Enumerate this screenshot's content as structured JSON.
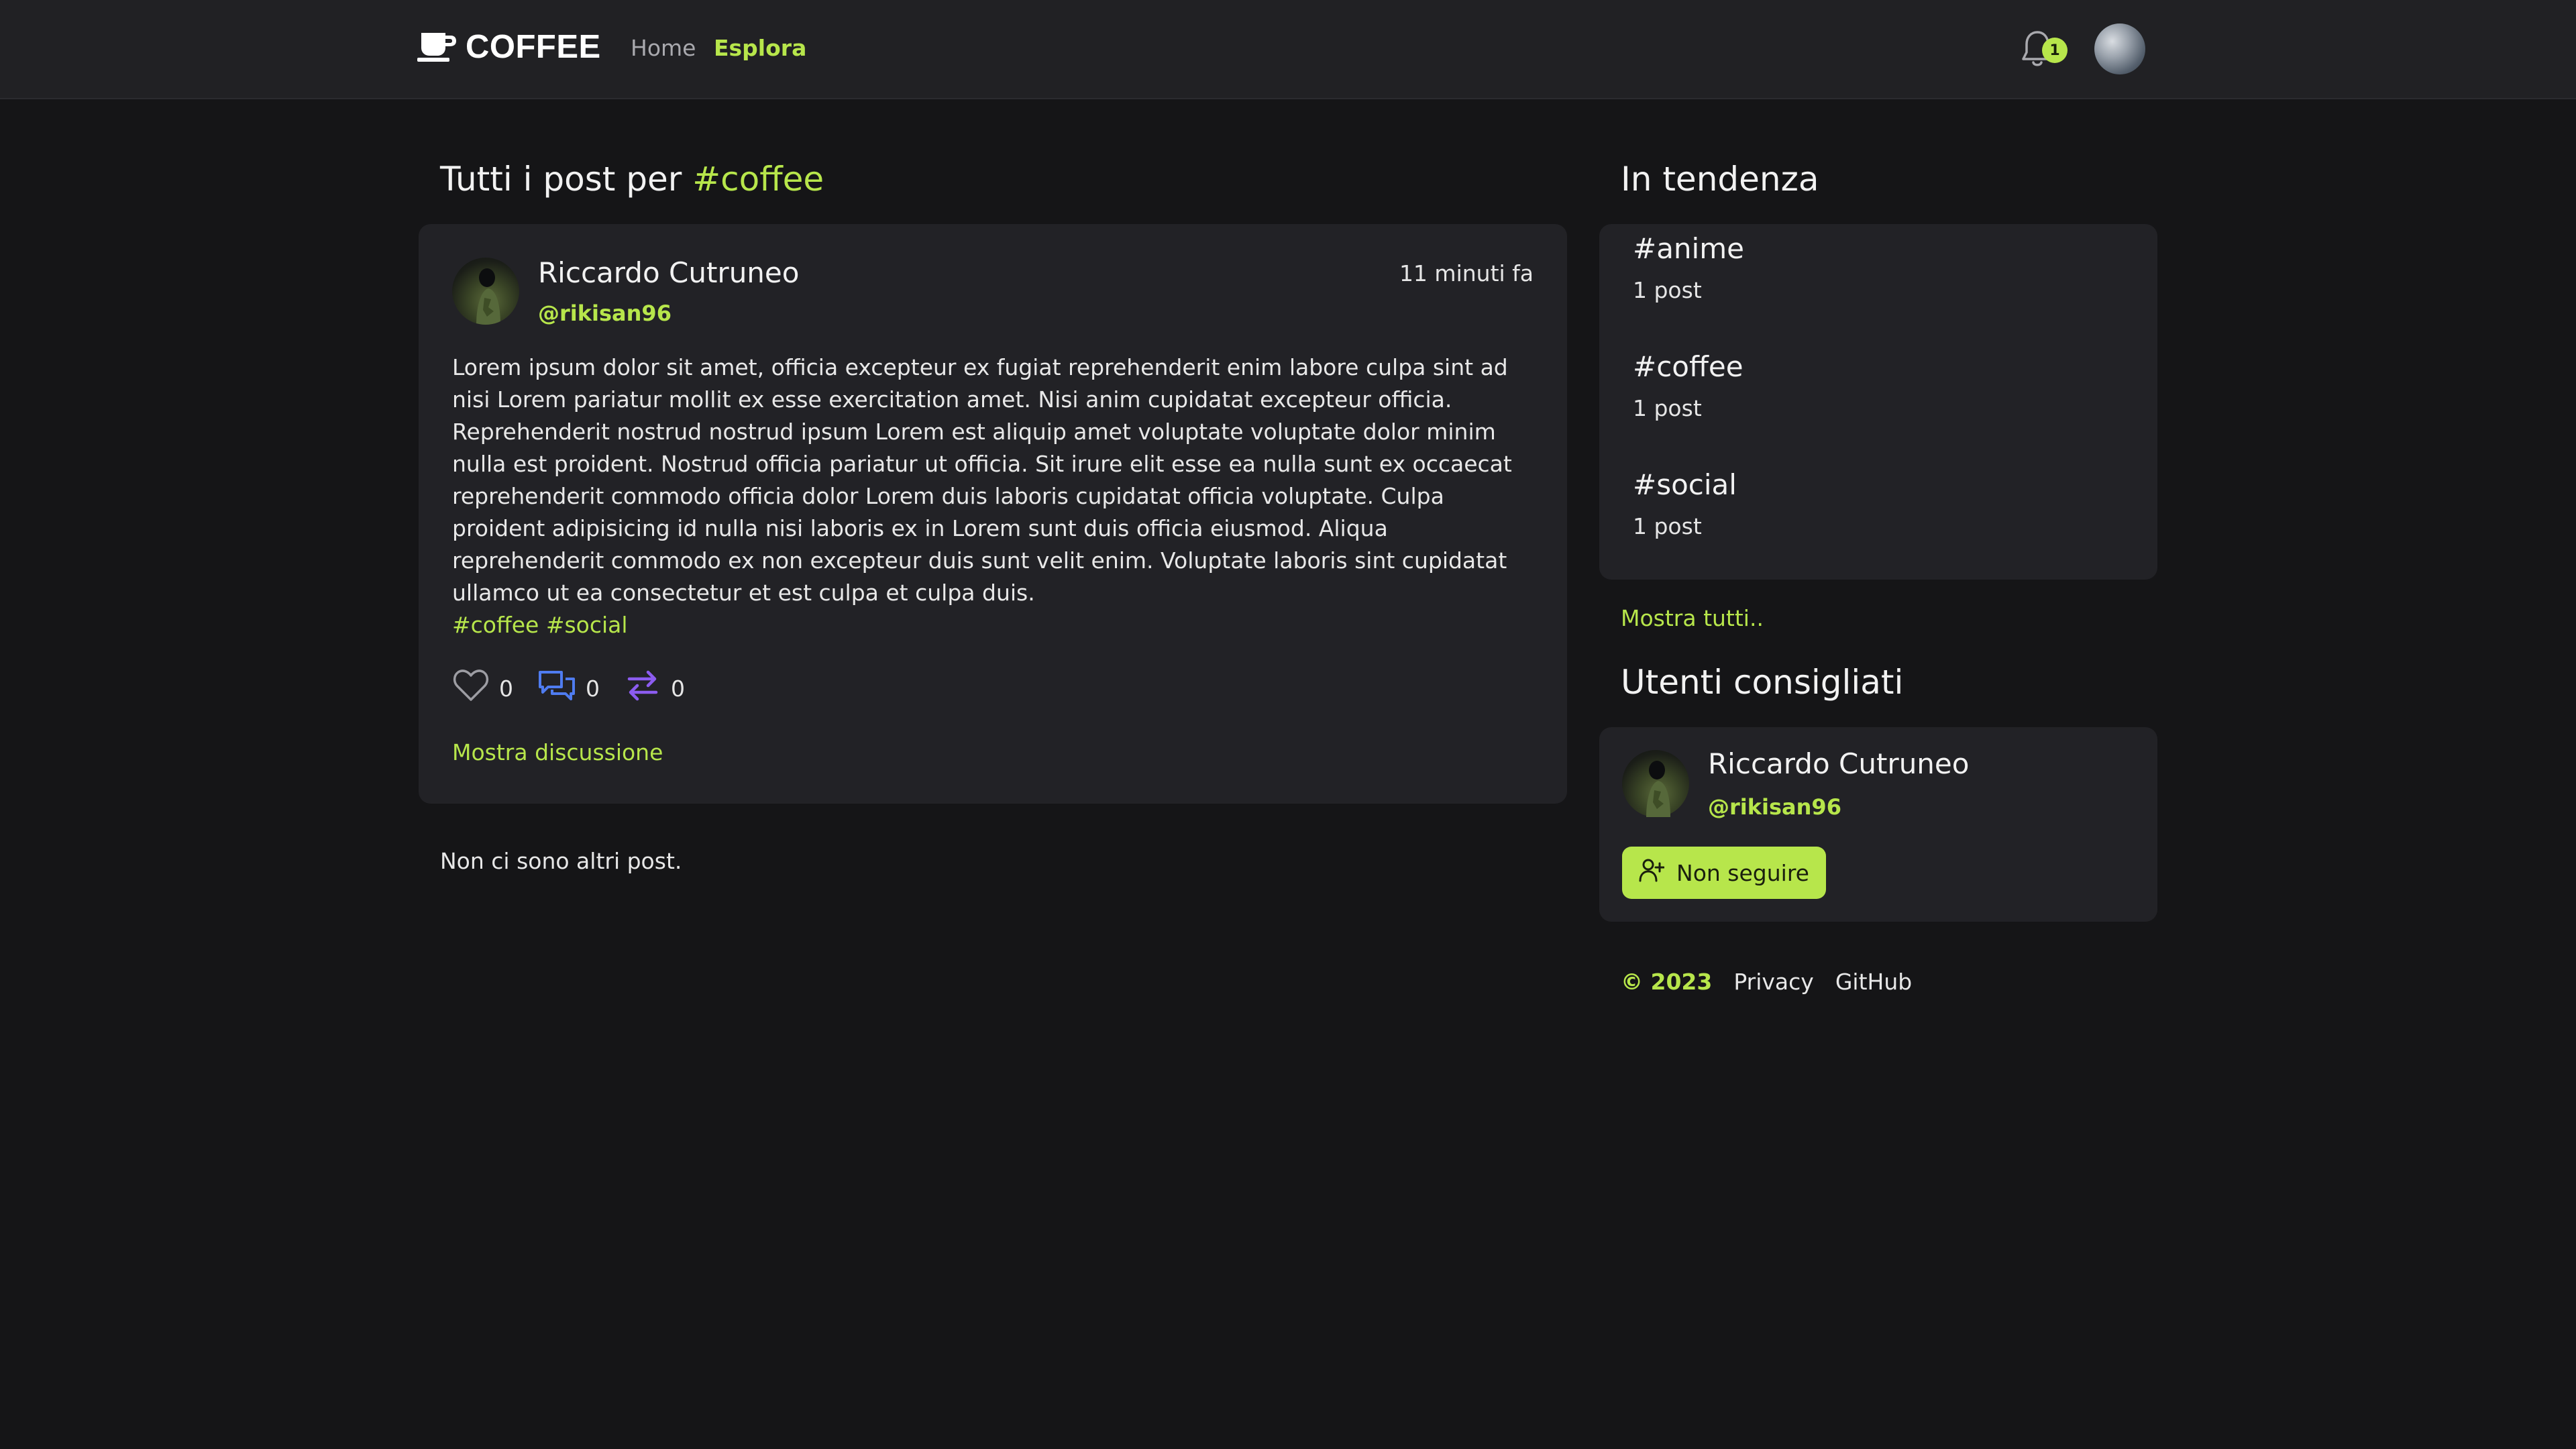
{
  "header": {
    "brand": "COFFEE",
    "nav": {
      "home": "Home",
      "explore": "Esplora"
    },
    "notifications_count": "1"
  },
  "main": {
    "title_prefix": "Tutti i post per ",
    "title_tag": "#coffee",
    "post": {
      "author": "Riccardo Cutruneo",
      "handle": "@rikisan96",
      "time": "11 minuti fa",
      "body": "Lorem ipsum dolor sit amet, officia excepteur ex fugiat reprehenderit enim labore culpa sint ad nisi Lorem pariatur mollit ex esse exercitation amet. Nisi anim cupidatat excepteur officia. Reprehenderit nostrud nostrud ipsum Lorem est aliquip amet voluptate voluptate dolor minim nulla est proident. Nostrud officia pariatur ut officia. Sit irure elit esse ea nulla sunt ex occaecat reprehenderit commodo officia dolor Lorem duis laboris cupidatat officia voluptate. Culpa proident adipisicing id nulla nisi laboris ex in Lorem sunt duis officia eiusmod. Aliqua reprehenderit commodo ex non excepteur duis sunt velit enim. Voluptate laboris sint cupidatat ullamco ut ea consectetur et est culpa et culpa duis.",
      "tags": "#coffee #social",
      "likes": "0",
      "comments": "0",
      "reposts": "0",
      "show_discussion": "Mostra discussione"
    },
    "no_more": "Non ci sono altri post."
  },
  "sidebar": {
    "trending_title": "In tendenza",
    "trending": [
      {
        "tag": "#anime",
        "count": "1 post"
      },
      {
        "tag": "#coffee",
        "count": "1 post"
      },
      {
        "tag": "#social",
        "count": "1 post"
      }
    ],
    "show_all": "Mostra tutti..",
    "suggested_title": "Utenti consigliati",
    "suggested_user": {
      "name": "Riccardo Cutruneo",
      "handle": "@rikisan96",
      "button": "Non seguire"
    }
  },
  "footer": {
    "copyright": "© 2023",
    "privacy": "Privacy",
    "github": "GitHub"
  },
  "colors": {
    "accent": "#b7e64b",
    "background": "#151517",
    "card": "#222226",
    "header": "#212124",
    "comment_icon": "#4f7cf0",
    "repost_icon": "#8c5cf0"
  }
}
